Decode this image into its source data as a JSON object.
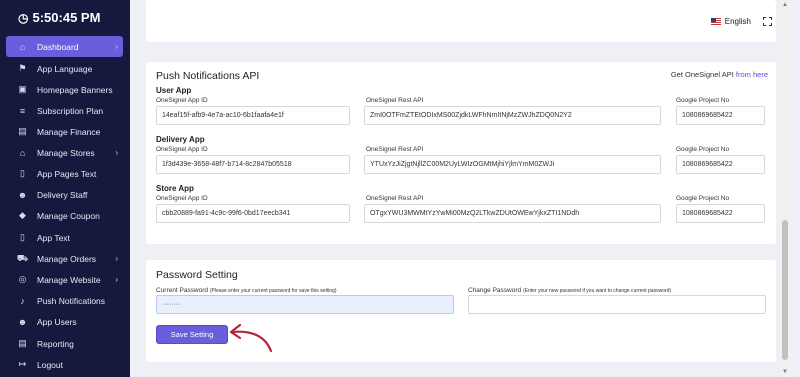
{
  "sidebar": {
    "time": "5:50:45 PM",
    "items": [
      {
        "label": "Dashboard",
        "icon": "home-icon",
        "glyph": "⌂",
        "chevron": "›"
      },
      {
        "label": "App Language",
        "icon": "flag-icon",
        "glyph": "⚑",
        "chevron": ""
      },
      {
        "label": "Homepage Banners",
        "icon": "image-icon",
        "glyph": "▣",
        "chevron": ""
      },
      {
        "label": "Subscription Plan",
        "icon": "list-icon",
        "glyph": "≡",
        "chevron": ""
      },
      {
        "label": "Manage Finance",
        "icon": "money-icon",
        "glyph": "▤",
        "chevron": ""
      },
      {
        "label": "Manage Stores",
        "icon": "store-icon",
        "glyph": "⌂",
        "chevron": "›"
      },
      {
        "label": "App Pages Text",
        "icon": "file-icon",
        "glyph": "▯",
        "chevron": ""
      },
      {
        "label": "Delivery Staff",
        "icon": "user-icon",
        "glyph": "☻",
        "chevron": ""
      },
      {
        "label": "Manage Coupon",
        "icon": "tag-icon",
        "glyph": "◆",
        "chevron": ""
      },
      {
        "label": "App Text",
        "icon": "phone-icon",
        "glyph": "▯",
        "chevron": ""
      },
      {
        "label": "Manage Orders",
        "icon": "cart-icon",
        "glyph": "⛟",
        "chevron": "›"
      },
      {
        "label": "Manage Website",
        "icon": "globe-icon",
        "glyph": "◎",
        "chevron": "›"
      },
      {
        "label": "Push Notifications",
        "icon": "bell-icon",
        "glyph": "♪",
        "chevron": ""
      },
      {
        "label": "App Users",
        "icon": "users-icon",
        "glyph": "☻",
        "chevron": ""
      },
      {
        "label": "Reporting",
        "icon": "report-icon",
        "glyph": "▤",
        "chevron": ""
      },
      {
        "label": "Logout",
        "icon": "logout-icon",
        "glyph": "↦",
        "chevron": ""
      }
    ]
  },
  "topbar": {
    "language": "English"
  },
  "push_api": {
    "title": "Push Notifications API",
    "link_prefix": "Get OneSignel API",
    "link_text": "from here",
    "sections": [
      {
        "title": "User App",
        "app_id_label": "OneSignel App ID",
        "app_id": "14eaf15f-afb9-4e7a-ac10-6b1faafa4e1f",
        "rest_label": "OneSignel Rest API",
        "rest": "ZmI0OTFmZTEtODIxMS00ZjdkLWFhNmItNjMzZWJhZDQ0N2Y2",
        "project_label": "Google Project No",
        "project": "1080869685422"
      },
      {
        "title": "Delivery App",
        "app_id_label": "OneSignel App ID",
        "app_id": "1f3d439e-3658-48f7-b714-8c2847b05518",
        "rest_label": "OneSignel Rest API",
        "rest": "YTUxYzJiZjgtNjllZC00M2UyLWIzOGMtMjhiYjlmYmM0ZWJi",
        "project_label": "Google Project No",
        "project": "1080869685422"
      },
      {
        "title": "Store App",
        "app_id_label": "OneSignel App ID",
        "app_id": "cbb20889-fa91-4c9c-99f6-0bd17eecb341",
        "rest_label": "OneSignel Rest API",
        "rest": "OTgxYWU3MWMtYzYwMi00MzQ2LTkwZDUtOWEwYjkxZTI1NDdh",
        "project_label": "Google Project No",
        "project": "1080869685422"
      }
    ]
  },
  "password": {
    "title": "Password Setting",
    "current_label": "Current Password",
    "current_hint": "(Please enter your current password for save this setting)",
    "current_value": "········",
    "change_label": "Change Password",
    "change_hint": "(Enter your new password if you want to change current password)",
    "change_value": "",
    "save_label": "Save Setting"
  },
  "colors": {
    "sidebar": "#14193d",
    "accent": "#6a5edc",
    "annotation": "#b3263a"
  }
}
